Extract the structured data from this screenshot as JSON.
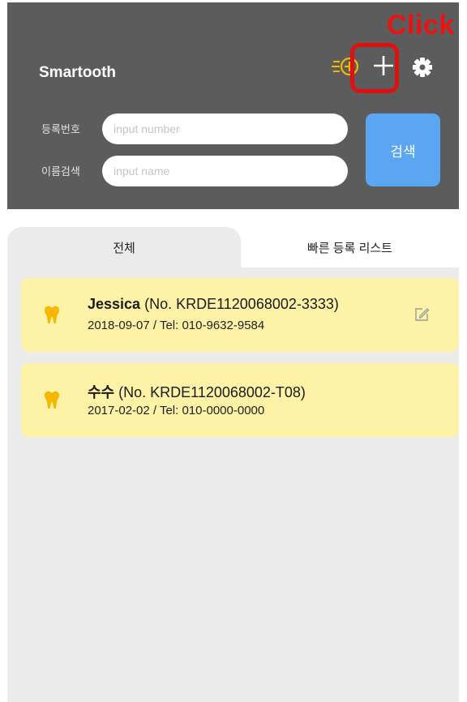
{
  "header": {
    "title": "Smartooth",
    "icons": {
      "quick_add": "quick-add-icon",
      "add": "add-icon",
      "settings": "settings-icon"
    },
    "colors": {
      "background": "#5c5c5c",
      "quick_add_icon": "#f5b800",
      "search_button": "#5aa6f2"
    }
  },
  "annotation": {
    "label": "Click",
    "color": "#ee1111"
  },
  "search": {
    "number_label": "등록번호",
    "number_placeholder": "input number",
    "name_label": "이름검색",
    "name_placeholder": "input name",
    "button_label": "검색"
  },
  "tabs": [
    {
      "label": "전체",
      "selected": true
    },
    {
      "label": "빠른 등록 리스트",
      "selected": false
    }
  ],
  "patients": [
    {
      "name": "Jessica",
      "number": " (No. KRDE1120068002-3333)",
      "details": "2018-09-07   /   Tel: 010-9632-9584",
      "editable": true
    },
    {
      "name": "수수",
      "number": " (No. KRDE1120068002-T08)",
      "details": "2017-02-02   /   Tel: 010-0000-0000",
      "editable": false
    }
  ],
  "card_color": "#fdf2a6",
  "tooth_color": "#f5b800"
}
